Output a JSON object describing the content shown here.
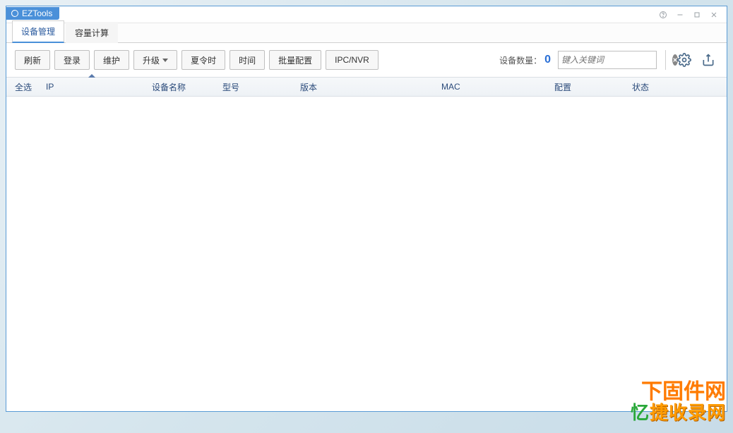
{
  "titlebar": {
    "app_name": "EZTools"
  },
  "tabs": {
    "device_mgmt": "设备管理",
    "capacity_calc": "容量计算"
  },
  "toolbar": {
    "refresh": "刷新",
    "login": "登录",
    "maintain": "维护",
    "upgrade": "升级",
    "dst": "夏令时",
    "time": "时间",
    "batch_config": "批量配置",
    "ipc_nvr": "IPC/NVR",
    "device_count_label": "设备数量：",
    "device_count_value": "0",
    "search_placeholder": "键入关键词"
  },
  "columns": {
    "all": "全选",
    "ip": "IP",
    "name": "设备名称",
    "model": "型号",
    "version": "版本",
    "mac": "MAC",
    "config": "配置",
    "status": "状态"
  },
  "rows": [],
  "watermarks": {
    "w1": "下固件网",
    "w2a": "忆",
    "w2b": "捷收录网"
  }
}
